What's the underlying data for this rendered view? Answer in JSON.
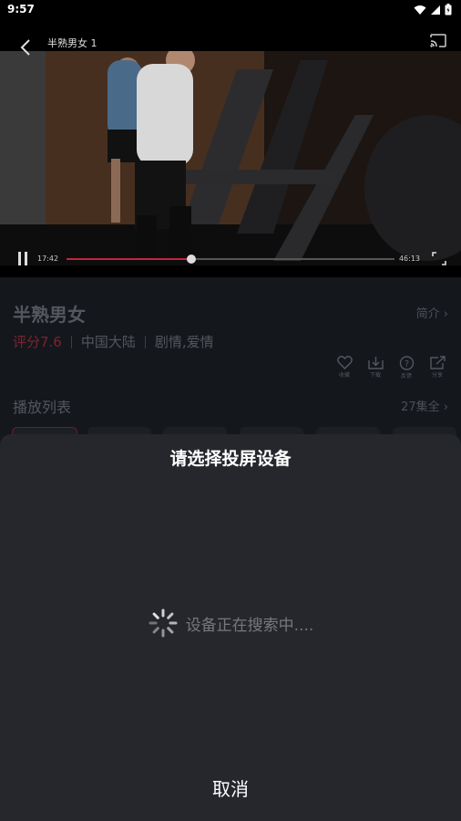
{
  "status_bar": {
    "time": "9:57",
    "icons": [
      "wifi-icon",
      "signal-icon",
      "battery-icon"
    ]
  },
  "player": {
    "title": "半熟男女 1",
    "current_time": "17:42",
    "total_time": "46:13",
    "progress": 0.38,
    "icons": [
      "back-icon",
      "cast-icon",
      "pause-icon",
      "fullscreen-icon"
    ],
    "progress_color": "#c2263a"
  },
  "show": {
    "title": "半熟男女",
    "intro_label": "简介 ›",
    "rating": "评分7.6",
    "region": "中国大陆",
    "genres": "剧情,爱情",
    "actions": [
      {
        "icon": "heart-icon",
        "label": "收藏"
      },
      {
        "icon": "download-icon",
        "label": "下载"
      },
      {
        "icon": "help-icon",
        "label": "反馈"
      },
      {
        "icon": "share-icon",
        "label": "分享"
      }
    ]
  },
  "playlist": {
    "title": "播放列表",
    "count": "27集全 ›"
  },
  "cast_sheet": {
    "title": "请选择投屏设备",
    "searching_text": "设备正在搜索中....",
    "cancel_label": "取消"
  }
}
